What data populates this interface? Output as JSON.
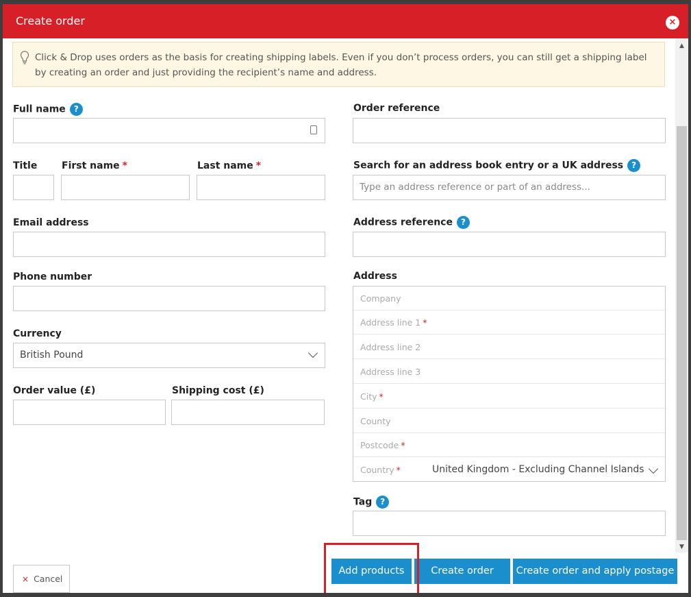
{
  "modal": {
    "title": "Create order",
    "close_symbol": "×",
    "info_text": "Click & Drop uses orders as the basis for creating shipping labels. Even if you don’t process orders, you can still get a shipping label by creating an order and just providing the recipient’s name and address."
  },
  "left": {
    "full_name_label": "Full name",
    "title_label": "Title",
    "first_name_label": "First name",
    "last_name_label": "Last name",
    "email_label": "Email address",
    "phone_label": "Phone number",
    "currency_label": "Currency",
    "currency_value": "British Pound",
    "order_value_label": "Order value (£)",
    "shipping_cost_label": "Shipping cost (£)"
  },
  "right": {
    "order_reference_label": "Order reference",
    "search_label": "Search for an address book entry or a UK address",
    "search_placeholder": "Type an address reference or part of an address...",
    "address_reference_label": "Address reference",
    "address_label": "Address",
    "address_fields": {
      "company": "Company",
      "line1": "Address line 1",
      "line2": "Address line 2",
      "line3": "Address line 3",
      "city": "City",
      "county": "County",
      "postcode": "Postcode",
      "country": "Country",
      "country_value": "United Kingdom - Excluding Channel Islands"
    },
    "tag_label": "Tag"
  },
  "common": {
    "required_mark": "*",
    "help_mark": "?"
  },
  "footer": {
    "cancel_symbol": "×",
    "cancel": "Cancel",
    "add_products": "Add products",
    "create_order": "Create order",
    "create_and_postage": "Create order and apply postage"
  },
  "colors": {
    "brand_red": "#d71f27",
    "button_blue": "#1b8fce",
    "info_bg": "#fdf7e3"
  },
  "icons": [
    "close-icon",
    "lightbulb-icon",
    "contact-card-icon",
    "help-icon",
    "chevron-down-icon",
    "scroll-up-icon",
    "scroll-down-icon"
  ]
}
